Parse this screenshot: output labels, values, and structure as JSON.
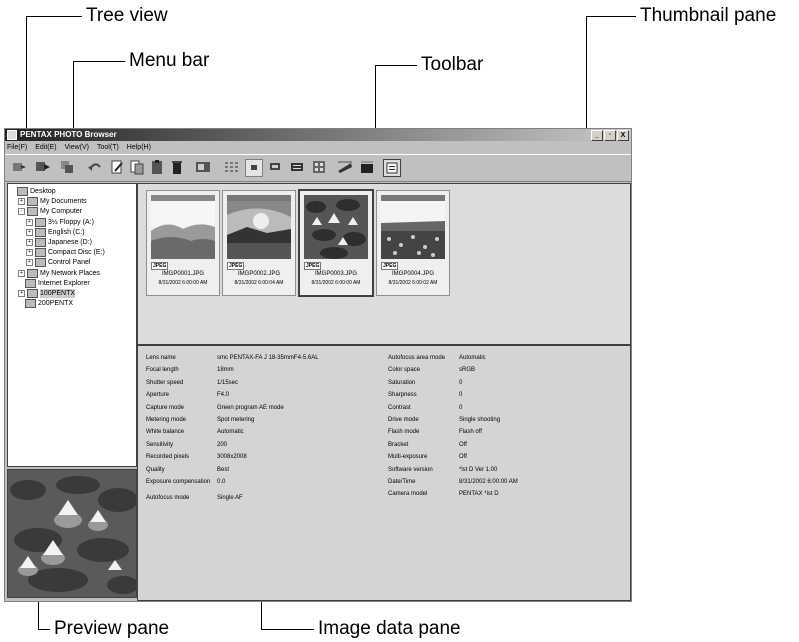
{
  "callouts": {
    "tree_view": "Tree view",
    "menu_bar": "Menu bar",
    "toolbar": "Toolbar",
    "thumbnail_pane": "Thumbnail pane",
    "preview_pane": "Preview pane",
    "image_data_pane": "Image data pane"
  },
  "window": {
    "title": "PENTAX PHOTO Browser",
    "min": "_",
    "max": "̸",
    "close": "X"
  },
  "menu": [
    "File(F)",
    "Edit(E)",
    "View(V)",
    "Tool(T)",
    "Help(H)"
  ],
  "toolbar_icons": [
    "copy-to-icon",
    "move-to-icon",
    "copy-icon",
    "undo-icon",
    "rename-icon",
    "paste-icon",
    "clipboard-icon",
    "delete-icon",
    "properties-icon",
    "large-thumbs-icon",
    "small-thumbs-icon",
    "list-icon",
    "details-icon",
    "slideshow-icon",
    "print-icon",
    "pentax-viewer-icon",
    "pentax-remote-icon",
    "settings-icon"
  ],
  "tree": [
    {
      "label": "Desktop",
      "level": 0,
      "exp": ""
    },
    {
      "label": "My Documents",
      "level": 1,
      "exp": "+"
    },
    {
      "label": "My Computer",
      "level": 1,
      "exp": "-"
    },
    {
      "label": "3½ Floppy (A:)",
      "level": 2,
      "exp": "+"
    },
    {
      "label": "English (C:)",
      "level": 2,
      "exp": "+"
    },
    {
      "label": "Japanese (D:)",
      "level": 2,
      "exp": "+"
    },
    {
      "label": "Compact Disc (E:)",
      "level": 2,
      "exp": "+"
    },
    {
      "label": "Control Panel",
      "level": 2,
      "exp": "+"
    },
    {
      "label": "My Network Places",
      "level": 1,
      "exp": "+"
    },
    {
      "label": "Internet Explorer",
      "level": 1,
      "exp": ""
    },
    {
      "label": "100PENTX",
      "level": 1,
      "exp": "+",
      "selected": true
    },
    {
      "label": "200PENTX",
      "level": 1,
      "exp": ""
    }
  ],
  "thumbnails": [
    {
      "format": "JPEG",
      "filename": "IMGP0001.JPG",
      "datetime": "8/31/2002 6:00:00 AM",
      "scene": "mountains"
    },
    {
      "format": "JPEG",
      "filename": "IMGP0002.JPG",
      "datetime": "8/31/2002 6:00:04 AM",
      "scene": "sunset"
    },
    {
      "format": "JPEG",
      "filename": "IMGP0003.JPG",
      "datetime": "8/31/2002 6:00:00 AM",
      "scene": "lilies",
      "selected": true
    },
    {
      "format": "JPEG",
      "filename": "IMGP0004.JPG",
      "datetime": "8/31/2002 6:00:02 AM",
      "scene": "flowers"
    }
  ],
  "image_data_left": [
    {
      "key": "Lens name",
      "value": "smc PENTAX-FA J 18-35mmF4-5.6AL"
    },
    {
      "key": "Focal length",
      "value": "18mm"
    },
    {
      "key": "Shutter speed",
      "value": "1/15sec"
    },
    {
      "key": "Aperture",
      "value": "F4.0"
    },
    {
      "key": "Capture mode",
      "value": "Green program AE mode"
    },
    {
      "key": "Metering mode",
      "value": "Spot metering"
    },
    {
      "key": "White balance",
      "value": "Automatic"
    },
    {
      "key": "Sensitivity",
      "value": "200"
    },
    {
      "key": "Recorded pixels",
      "value": "3008x2008"
    },
    {
      "key": "Quality",
      "value": "Best"
    },
    {
      "key": "Exposure compensation",
      "value": "0.0"
    },
    {
      "key": "Autofocus mode",
      "value": "Single AF"
    }
  ],
  "image_data_right": [
    {
      "key": "Autofocus area mode",
      "value": "Automatic"
    },
    {
      "key": "Color space",
      "value": "sRGB"
    },
    {
      "key": "Saturation",
      "value": "0"
    },
    {
      "key": "Sharpness",
      "value": "0"
    },
    {
      "key": "Contrast",
      "value": "0"
    },
    {
      "key": "Drive mode",
      "value": "Single shooting"
    },
    {
      "key": "Flash mode",
      "value": "Flash off"
    },
    {
      "key": "Bracket",
      "value": "Off"
    },
    {
      "key": "Multi-exposure",
      "value": "Off"
    },
    {
      "key": "Software version",
      "value": "*ist D    Ver 1.00"
    },
    {
      "key": "Date/Time",
      "value": "8/31/2002 6:00:00 AM"
    },
    {
      "key": "Camera model",
      "value": "PENTAX *ist D"
    }
  ]
}
